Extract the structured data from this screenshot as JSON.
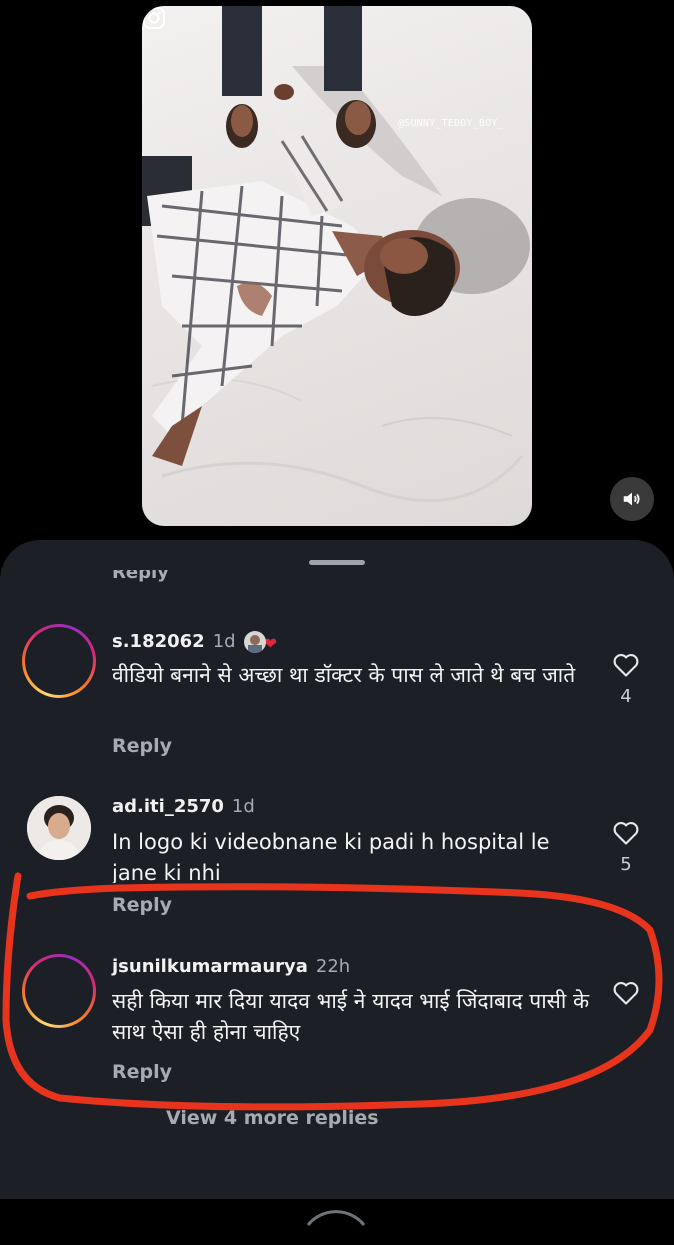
{
  "video": {
    "watermark": "@SUNNY_TEDDY_BOY_",
    "icons": {
      "instagram": "instagram-icon",
      "sound": "speaker-icon"
    }
  },
  "sheet": {
    "partial_reply_label": "Reply",
    "view_more_label": "View 4 more replies"
  },
  "comments": [
    {
      "username": "s.182062",
      "time": "1d",
      "text": "वीडियो बनाने से  अच्छा था डॉक्टर के पास ले जाते थे बच जाते",
      "reply_label": "Reply",
      "likes": "4"
    },
    {
      "username": "ad.iti_2570",
      "time": "1d",
      "text": "In logo ki videobnane ki padi h hospital le jane ki nhi",
      "reply_label": "Reply",
      "likes": "5"
    },
    {
      "username": "jsunilkumarmaurya",
      "time": "22h",
      "text": "सही किया मार दिया यादव भाई ने यादव भाई जिंदाबाद पासी के साथ ऐसा ही होना चाहिए",
      "reply_label": "Reply",
      "likes": ""
    }
  ],
  "colors": {
    "sheet_background": "#1c2026",
    "annotation_red": "#e8341c",
    "like_heart": "#e2263d"
  }
}
